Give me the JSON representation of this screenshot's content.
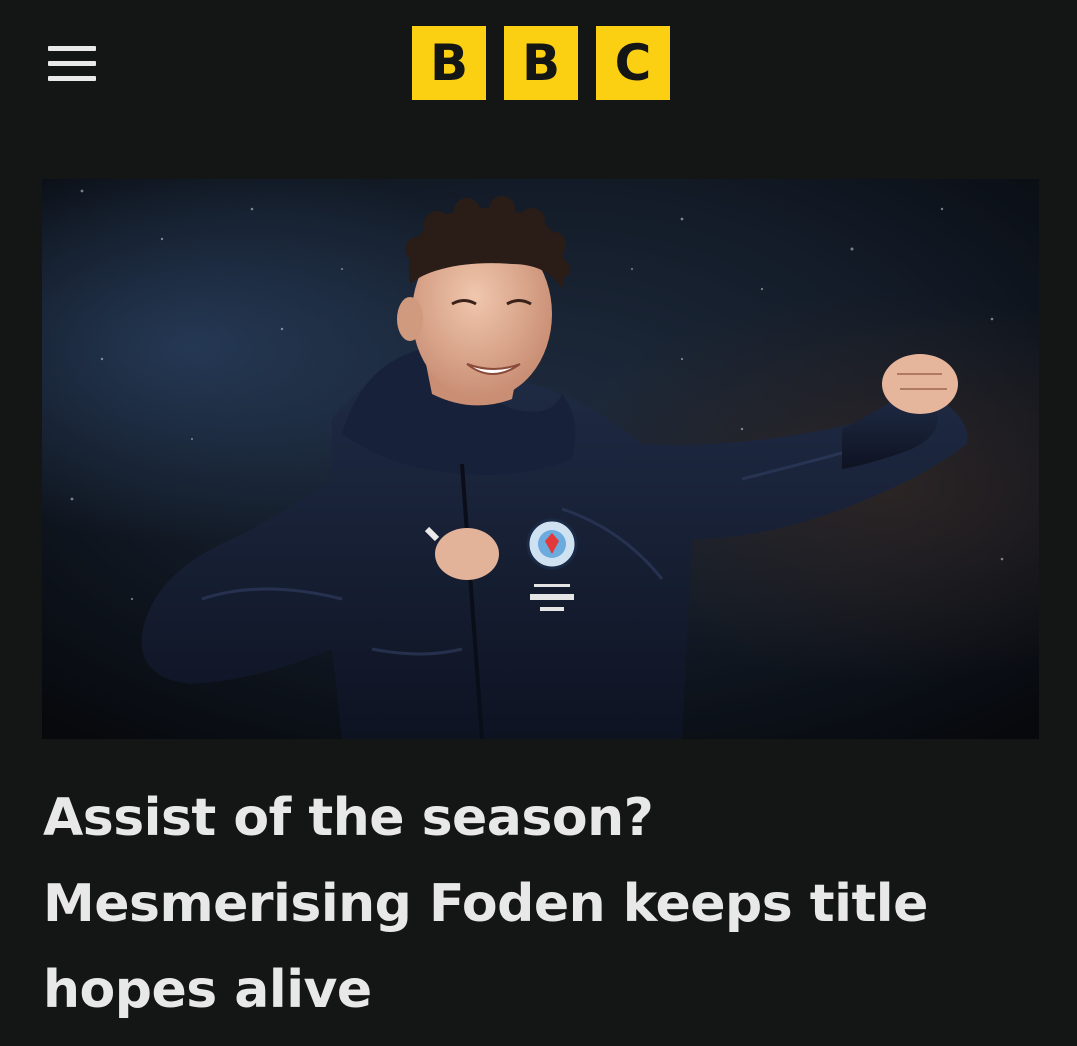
{
  "header": {
    "menu_icon": "hamburger-menu-icon",
    "logo": {
      "letters": [
        "B",
        "B",
        "C"
      ],
      "block_color": "#fbd012",
      "letter_color": "#141515"
    }
  },
  "article": {
    "headline": "Assist of the season? Mesmerising Foden keeps title hopes alive"
  },
  "colors": {
    "background": "#141515",
    "text": "#e8e8e8"
  }
}
